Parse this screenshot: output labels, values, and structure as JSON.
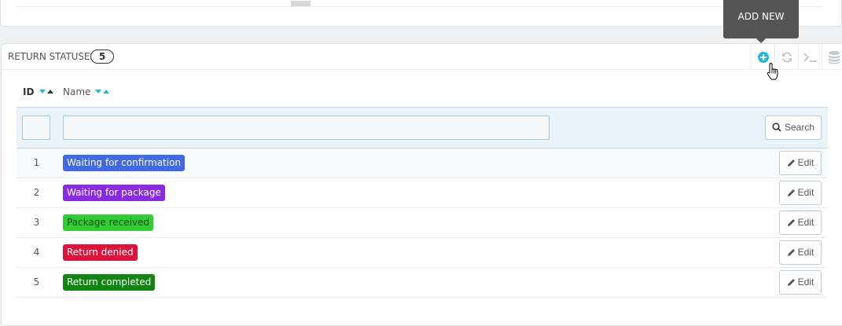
{
  "tooltip": {
    "text": "ADD NEW"
  },
  "panel": {
    "title": "RETURN STATUSES",
    "count": "5"
  },
  "toolbar": [
    {
      "name": "add-new-button",
      "icon": "plus-circle-icon"
    },
    {
      "name": "refresh-button",
      "icon": "refresh-icon"
    },
    {
      "name": "sql-query-button",
      "icon": "terminal-icon"
    },
    {
      "name": "export-button",
      "icon": "database-icon"
    }
  ],
  "table": {
    "columns": {
      "id": "ID",
      "name": "Name"
    },
    "filter": {
      "id_value": "",
      "name_value": "",
      "search_label": "Search"
    },
    "rows": [
      {
        "id": "1",
        "name": "Waiting for confirmation",
        "color": "#4169e1",
        "edit": "Edit"
      },
      {
        "id": "2",
        "name": "Waiting for package",
        "color": "#8a2be2",
        "edit": "Edit"
      },
      {
        "id": "3",
        "name": "Package received",
        "color": "#32cd32",
        "edit": "Edit"
      },
      {
        "id": "4",
        "name": "Return denied",
        "color": "#dc143c",
        "edit": "Edit"
      },
      {
        "id": "5",
        "name": "Return completed",
        "color": "#108510",
        "edit": "Edit"
      }
    ]
  },
  "colors": {
    "accent": "#25b9d7"
  }
}
